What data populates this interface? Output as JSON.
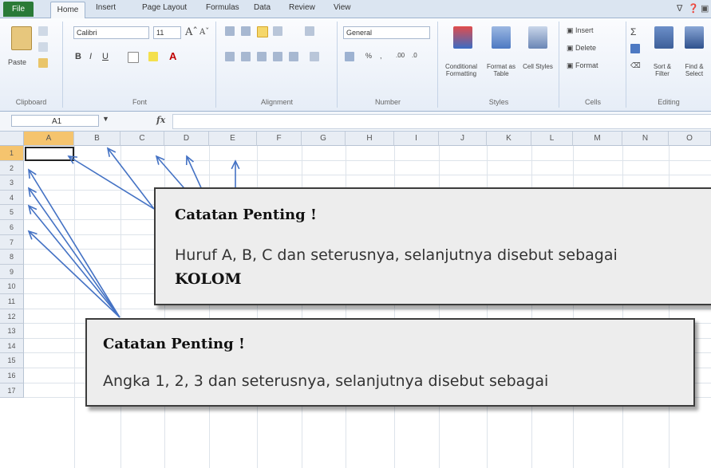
{
  "tabs": {
    "file": "File",
    "home": "Home",
    "insert": "Insert",
    "page_layout": "Page Layout",
    "formulas": "Formulas",
    "data": "Data",
    "review": "Review",
    "view": "View"
  },
  "ribbon": {
    "clipboard": {
      "label": "Clipboard",
      "paste": "Paste"
    },
    "font": {
      "label": "Font",
      "name": "Calibri",
      "size": "11"
    },
    "alignment": {
      "label": "Alignment"
    },
    "number": {
      "label": "Number",
      "format": "General"
    },
    "styles": {
      "label": "Styles",
      "conditional_formatting": "Conditional Formatting",
      "format_as_table": "Format as Table",
      "cell_styles": "Cell Styles"
    },
    "cells": {
      "label": "Cells",
      "insert": "Insert",
      "delete": "Delete",
      "format": "Format"
    },
    "editing": {
      "label": "Editing",
      "sort_filter": "Sort & Filter",
      "find_select": "Find & Select"
    }
  },
  "formula_bar": {
    "name_box": "A1",
    "fx": "fx"
  },
  "columns": [
    "A",
    "B",
    "C",
    "D",
    "E",
    "F",
    "G",
    "H",
    "I",
    "J",
    "K",
    "L",
    "M",
    "N",
    "O"
  ],
  "rows": [
    "1",
    "2",
    "3",
    "4",
    "5",
    "6",
    "7",
    "8",
    "9",
    "10",
    "11",
    "12",
    "13",
    "14",
    "15",
    "16",
    "17"
  ],
  "note1": {
    "title": "Catatan Penting !",
    "body": "Huruf A, B, C dan seterusnya, selanjutnya disebut sebagai",
    "emphasis": "KOLOM"
  },
  "note2": {
    "title": "Catatan Penting !",
    "body": "Angka 1, 2, 3 dan seterusnya, selanjutnya disebut sebagai"
  },
  "colors": {
    "arrow": "#4472c4",
    "file_tab": "#2a7a37",
    "selected_header": "#f5c46e"
  }
}
